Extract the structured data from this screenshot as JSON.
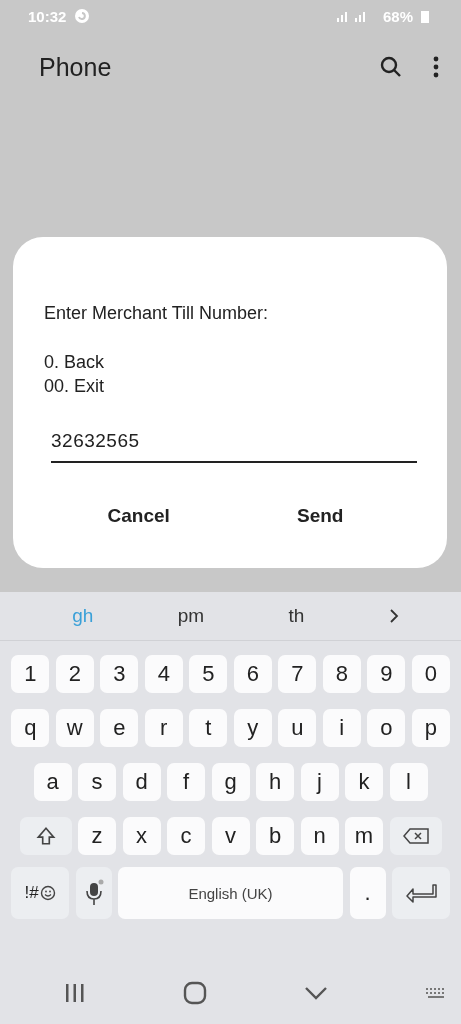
{
  "status_bar": {
    "time": "10:32",
    "battery": "68%"
  },
  "app_bar": {
    "title": "Phone"
  },
  "dialog": {
    "message": "Enter Merchant Till Number:",
    "options": [
      "0. Back",
      "00. Exit"
    ],
    "input": {
      "value": "32632565"
    },
    "buttons": [
      "Cancel",
      "Send"
    ]
  },
  "keyboard": {
    "suggestions": [
      {
        "text": "gh",
        "selected": true
      },
      {
        "text": "pm",
        "selected": false
      },
      {
        "text": "th",
        "selected": false
      }
    ],
    "rows": [
      [
        "1",
        "2",
        "3",
        "4",
        "5",
        "6",
        "7",
        "8",
        "9",
        "0"
      ],
      [
        "q",
        "w",
        "e",
        "r",
        "t",
        "y",
        "u",
        "i",
        "o",
        "p"
      ],
      [
        "a",
        "s",
        "d",
        "f",
        "g",
        "h",
        "j",
        "k",
        "l"
      ],
      [
        "z",
        "x",
        "c",
        "v",
        "b",
        "n",
        "m"
      ]
    ],
    "symbols_key": "!#",
    "space_key": "English (UK)",
    "period_key": "."
  }
}
